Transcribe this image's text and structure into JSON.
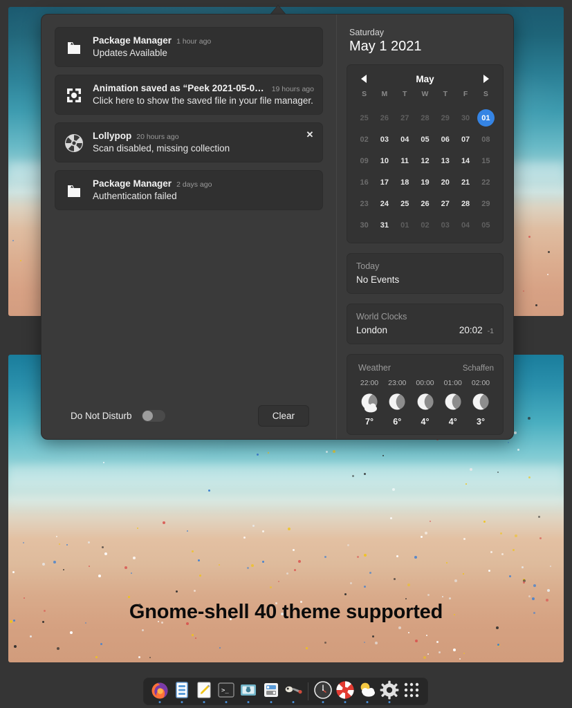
{
  "desktop": {
    "caption": "Gnome-shell 40 theme supported",
    "background_color": "#353535"
  },
  "panel": {
    "notifications": [
      {
        "icon": "package-icon",
        "title": "Package Manager",
        "time": "1 hour ago",
        "body": "Updates Available",
        "closable": false
      },
      {
        "icon": "screen-capture-icon",
        "title": "Animation saved as “Peek 2021-05-01 …",
        "time": "19 hours ago",
        "body": "Click here to show the saved file in your file manager.",
        "closable": false
      },
      {
        "icon": "lollypop-icon",
        "title": "Lollypop",
        "time": "20 hours ago",
        "body": "Scan disabled, missing collection",
        "closable": true,
        "close_label": "✕"
      },
      {
        "icon": "package-icon",
        "title": "Package Manager",
        "time": "2 days ago",
        "body": "Authentication failed",
        "closable": false
      }
    ],
    "footer": {
      "dnd_label": "Do Not Disturb",
      "dnd_enabled": false,
      "clear_label": "Clear"
    },
    "date": {
      "weekday": "Saturday",
      "full": "May 1 2021"
    },
    "calendar": {
      "month_label": "May",
      "prev_icon": "chevron-left-icon",
      "next_icon": "chevron-right-icon",
      "day_headers": [
        "S",
        "M",
        "T",
        "W",
        "T",
        "F",
        "S"
      ],
      "selected_day": "01",
      "accent_color": "#3584e4",
      "weeks": [
        [
          {
            "label": "25",
            "state": "other"
          },
          {
            "label": "26",
            "state": "other"
          },
          {
            "label": "27",
            "state": "other"
          },
          {
            "label": "28",
            "state": "other"
          },
          {
            "label": "29",
            "state": "other"
          },
          {
            "label": "30",
            "state": "other"
          },
          {
            "label": "01",
            "state": "today"
          }
        ],
        [
          {
            "label": "02",
            "state": "dim"
          },
          {
            "label": "03",
            "state": "normal"
          },
          {
            "label": "04",
            "state": "normal"
          },
          {
            "label": "05",
            "state": "normal"
          },
          {
            "label": "06",
            "state": "normal"
          },
          {
            "label": "07",
            "state": "normal"
          },
          {
            "label": "08",
            "state": "dim"
          }
        ],
        [
          {
            "label": "09",
            "state": "dim"
          },
          {
            "label": "10",
            "state": "normal"
          },
          {
            "label": "11",
            "state": "normal"
          },
          {
            "label": "12",
            "state": "normal"
          },
          {
            "label": "13",
            "state": "normal"
          },
          {
            "label": "14",
            "state": "normal"
          },
          {
            "label": "15",
            "state": "dim"
          }
        ],
        [
          {
            "label": "16",
            "state": "dim"
          },
          {
            "label": "17",
            "state": "normal"
          },
          {
            "label": "18",
            "state": "normal"
          },
          {
            "label": "19",
            "state": "normal"
          },
          {
            "label": "20",
            "state": "normal"
          },
          {
            "label": "21",
            "state": "normal"
          },
          {
            "label": "22",
            "state": "dim"
          }
        ],
        [
          {
            "label": "23",
            "state": "dim"
          },
          {
            "label": "24",
            "state": "normal"
          },
          {
            "label": "25",
            "state": "normal"
          },
          {
            "label": "26",
            "state": "normal"
          },
          {
            "label": "27",
            "state": "normal"
          },
          {
            "label": "28",
            "state": "normal"
          },
          {
            "label": "29",
            "state": "dim"
          }
        ],
        [
          {
            "label": "30",
            "state": "dim"
          },
          {
            "label": "31",
            "state": "normal"
          },
          {
            "label": "01",
            "state": "other"
          },
          {
            "label": "02",
            "state": "other"
          },
          {
            "label": "03",
            "state": "other"
          },
          {
            "label": "04",
            "state": "other"
          },
          {
            "label": "05",
            "state": "other"
          }
        ]
      ]
    },
    "events": {
      "title": "Today",
      "value": "No Events"
    },
    "world_clocks": {
      "title": "World Clocks",
      "entries": [
        {
          "city": "London",
          "time": "20:02",
          "offset": "-1"
        }
      ]
    },
    "weather": {
      "title": "Weather",
      "location": "Schaffen",
      "forecast": [
        {
          "time": "22:00",
          "temp": "7°",
          "icon": "moon-cloud-icon"
        },
        {
          "time": "23:00",
          "temp": "6°",
          "icon": "moon-icon"
        },
        {
          "time": "00:00",
          "temp": "4°",
          "icon": "moon-icon"
        },
        {
          "time": "01:00",
          "temp": "4°",
          "icon": "moon-icon"
        },
        {
          "time": "02:00",
          "temp": "3°",
          "icon": "moon-icon"
        }
      ]
    }
  },
  "dock": {
    "items": [
      {
        "name": "firefox-icon",
        "label": "Firefox",
        "running": true
      },
      {
        "name": "files-icon",
        "label": "Files",
        "running": true
      },
      {
        "name": "text-editor-icon",
        "label": "Text Editor",
        "running": true
      },
      {
        "name": "terminal-icon",
        "label": "Terminal",
        "running": true
      },
      {
        "name": "screenshot-icon",
        "label": "Screenshot",
        "running": true
      },
      {
        "name": "software-icon",
        "label": "Software",
        "running": true
      },
      {
        "name": "peek-icon",
        "label": "Peek",
        "running": true
      },
      {
        "name": "clocks-icon",
        "label": "Clocks",
        "running": true
      },
      {
        "name": "lollypop-icon",
        "label": "Lollypop",
        "running": true
      },
      {
        "name": "weather-icon",
        "label": "Weather",
        "running": true
      },
      {
        "name": "settings-icon",
        "label": "Settings",
        "running": true
      },
      {
        "name": "app-grid-icon",
        "label": "Show Applications",
        "running": false
      }
    ]
  }
}
